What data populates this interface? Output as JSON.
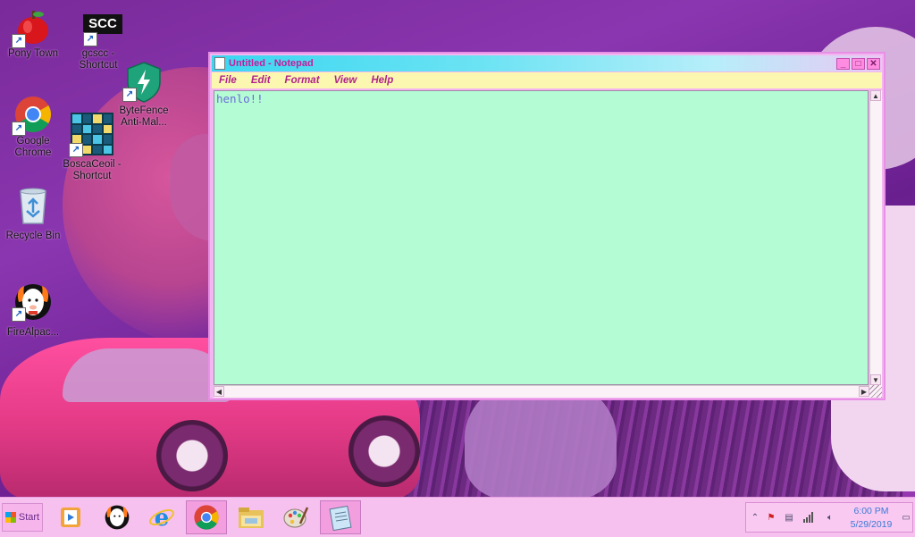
{
  "desktop": {
    "icons": [
      {
        "label_1": "Pony Town",
        "label_2": "",
        "icon": "apple-icon"
      },
      {
        "label_1": "gcscc -",
        "label_2": "Shortcut",
        "icon": "scc-logo-icon",
        "badge": "SCC"
      },
      {
        "label_1": "Google",
        "label_2": "Chrome",
        "icon": "chrome-icon"
      },
      {
        "label_1": "ByteFence",
        "label_2": "Anti-Mal...",
        "icon": "shield-icon"
      },
      {
        "label_1": "BoscaCeoil -",
        "label_2": "Shortcut",
        "icon": "sequencer-grid-icon"
      },
      {
        "label_1": "Recycle Bin",
        "label_2": "",
        "icon": "recycle-bin-icon"
      },
      {
        "label_1": "FireAlpac...",
        "label_2": "",
        "icon": "alpaca-icon"
      }
    ]
  },
  "notepad": {
    "title": "Untitled - Notepad",
    "menu": [
      "File",
      "Edit",
      "Format",
      "View",
      "Help"
    ],
    "content": "henlo!!",
    "controls": {
      "minimize": "_",
      "maximize": "□",
      "close": "✕"
    }
  },
  "taskbar": {
    "start_label": "Start",
    "pinned": [
      "media-player-icon",
      "firealpaca-icon",
      "internet-explorer-icon",
      "chrome-icon",
      "file-explorer-icon",
      "paint-icon",
      "notepad-icon"
    ],
    "clock": {
      "time": "6:00 PM",
      "date": "5/29/2019"
    }
  }
}
